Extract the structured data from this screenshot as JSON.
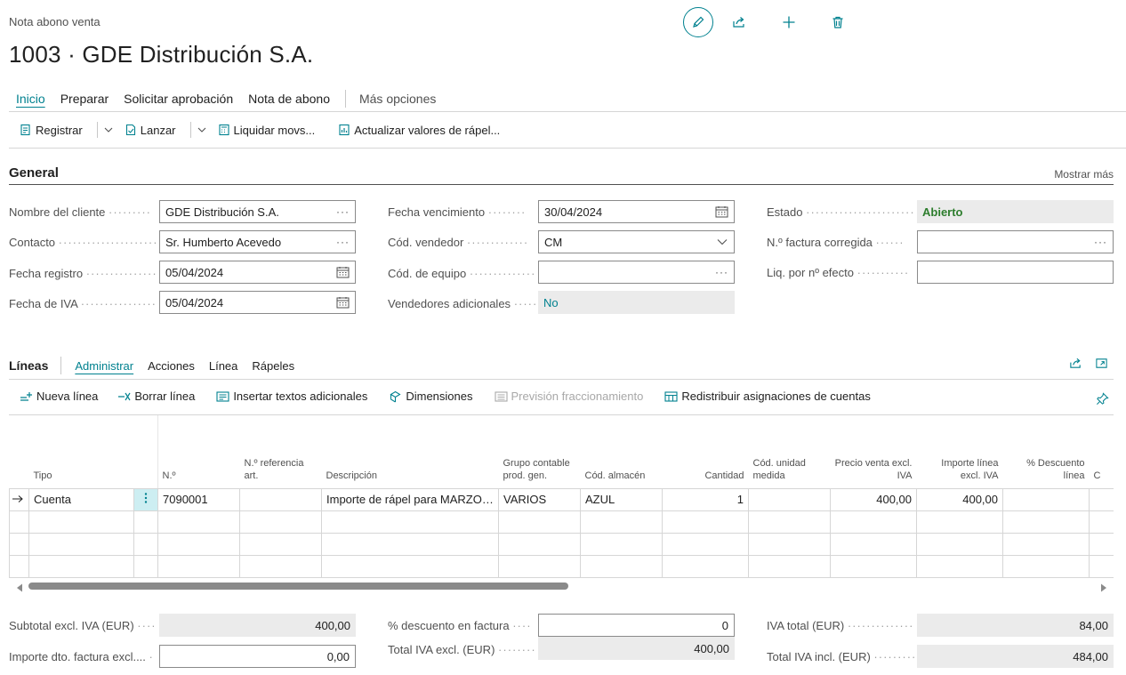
{
  "header": {
    "subtitle": "Nota abono venta",
    "title": "1003 · GDE Distribución S.A."
  },
  "menu": {
    "items": [
      "Inicio",
      "Preparar",
      "Solicitar aprobación",
      "Nota de abono"
    ],
    "more": "Más opciones"
  },
  "actions": {
    "register": "Registrar",
    "launch": "Lanzar",
    "settle": "Liquidar movs...",
    "update_rebates": "Actualizar valores de rápel..."
  },
  "general": {
    "title": "General",
    "show_more": "Mostrar más",
    "customer_name": {
      "label": "Nombre del cliente",
      "value": "GDE Distribución S.A."
    },
    "contact": {
      "label": "Contacto",
      "value": "Sr. Humberto Acevedo"
    },
    "posting_date": {
      "label": "Fecha registro",
      "value": "05/04/2024"
    },
    "vat_date": {
      "label": "Fecha de IVA",
      "value": "05/04/2024"
    },
    "due_date": {
      "label": "Fecha vencimiento",
      "value": "30/04/2024"
    },
    "salesperson": {
      "label": "Cód. vendedor",
      "value": "CM"
    },
    "team": {
      "label": "Cód. de equipo",
      "value": ""
    },
    "extra_salespeople": {
      "label": "Vendedores adicionales",
      "value": "No"
    },
    "status": {
      "label": "Estado",
      "value": "Abierto"
    },
    "corrected_invoice": {
      "label": "N.º factura corregida",
      "value": ""
    },
    "settle_by_doc": {
      "label": "Liq. por nº efecto",
      "value": ""
    }
  },
  "lines": {
    "title": "Líneas",
    "tabs": [
      "Administrar",
      "Acciones",
      "Línea",
      "Rápeles"
    ],
    "actions": {
      "new_line": "Nueva línea",
      "delete_line": "Borrar línea",
      "insert_texts": "Insertar textos adicionales",
      "dimensions": "Dimensiones",
      "split_forecast": "Previsión fraccionamiento",
      "redistribute": "Redistribuir asignaciones de cuentas"
    },
    "columns": {
      "type": "Tipo",
      "no": "N.º",
      "ref_no": "N.º referencia art.",
      "description": "Descripción",
      "gen_prod_group": "Grupo contable prod. gen.",
      "location": "Cód. almacén",
      "quantity": "Cantidad",
      "uom": "Cód. unidad medida",
      "unit_price": "Precio venta excl. IVA",
      "line_amount": "Importe línea excl. IVA",
      "discount": "% Descuento línea",
      "next": "C"
    },
    "rows": [
      {
        "type": "Cuenta",
        "no": "7090001",
        "ref_no": "",
        "description": "Importe de rápel para MARZO - ...",
        "gen_prod_group": "VARIOS",
        "location": "AZUL",
        "quantity": "1",
        "uom": "",
        "unit_price": "400,00",
        "line_amount": "400,00",
        "discount": ""
      }
    ]
  },
  "totals": {
    "subtotal": {
      "label": "Subtotal excl. IVA (EUR)",
      "value": "400,00"
    },
    "invoice_discount_amount": {
      "label": "Importe dto. factura excl....",
      "value": "0,00"
    },
    "invoice_discount_pct": {
      "label": "% descuento en factura",
      "value": "0"
    },
    "total_excl": {
      "label": "Total IVA excl. (EUR)",
      "value": "400,00"
    },
    "total_vat": {
      "label": "IVA total (EUR)",
      "value": "84,00"
    },
    "total_incl": {
      "label": "Total IVA incl. (EUR)",
      "value": "484,00"
    }
  },
  "colors": {
    "accent": "#00818f",
    "status_green": "#2d7d2d",
    "readonly_bg": "#ebebeb"
  }
}
